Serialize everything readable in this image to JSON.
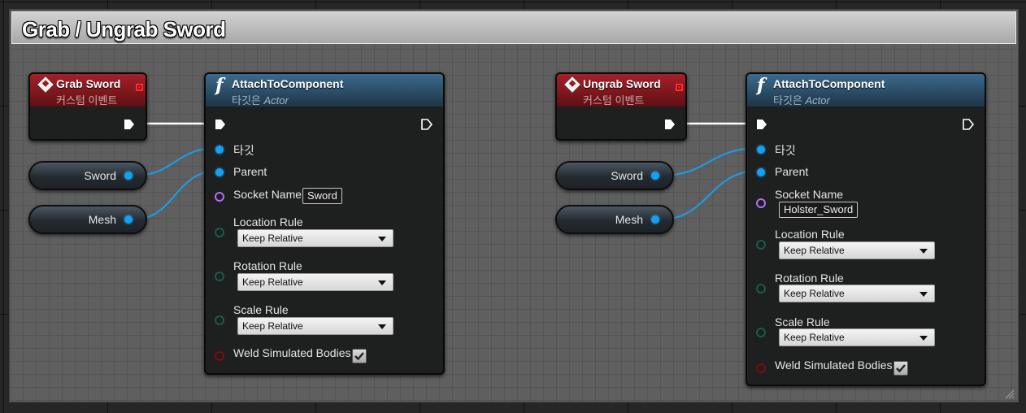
{
  "comment": {
    "title": "Grab / Ungrab Sword"
  },
  "colors": {
    "event_header": "#a5202a",
    "function_header": "#3c6a8e",
    "object_pin": "#16a0f0",
    "name_pin": "#b36ef5",
    "byte_pin": "#1a5a4c",
    "bool_pin": "#7d0c0c",
    "wire": "#16a0f0",
    "exec_wire": "#ffffff"
  },
  "left_group": {
    "event": {
      "title": "Grab Sword",
      "subtitle": "커스텀 이벤트",
      "icon": "custom-event-icon"
    },
    "vars": [
      {
        "label": "Sword"
      },
      {
        "label": "Mesh"
      }
    ],
    "func": {
      "title": "AttachToComponent",
      "subtitle_prefix": "타깃은",
      "subtitle_class": "Actor",
      "icon": "function-icon",
      "target_label": "타깃",
      "parent_label": "Parent",
      "socket_label": "Socket Name",
      "socket_value": "Sword",
      "location_label": "Location Rule",
      "location_value": "Keep Relative",
      "rotation_label": "Rotation Rule",
      "rotation_value": "Keep Relative",
      "scale_label": "Scale Rule",
      "scale_value": "Keep Relative",
      "weld_label": "Weld Simulated Bodies",
      "weld_checked": true
    }
  },
  "right_group": {
    "event": {
      "title": "Ungrab Sword",
      "subtitle": "커스텀 이벤트",
      "icon": "custom-event-icon"
    },
    "vars": [
      {
        "label": "Sword"
      },
      {
        "label": "Mesh"
      }
    ],
    "func": {
      "title": "AttachToComponent",
      "subtitle_prefix": "타깃은",
      "subtitle_class": "Actor",
      "icon": "function-icon",
      "target_label": "타깃",
      "parent_label": "Parent",
      "socket_label": "Socket Name",
      "socket_value": "Holster_Sword",
      "location_label": "Location Rule",
      "location_value": "Keep Relative",
      "rotation_label": "Rotation Rule",
      "rotation_value": "Keep Relative",
      "scale_label": "Scale Rule",
      "scale_value": "Keep Relative",
      "weld_label": "Weld Simulated Bodies",
      "weld_checked": true
    }
  }
}
